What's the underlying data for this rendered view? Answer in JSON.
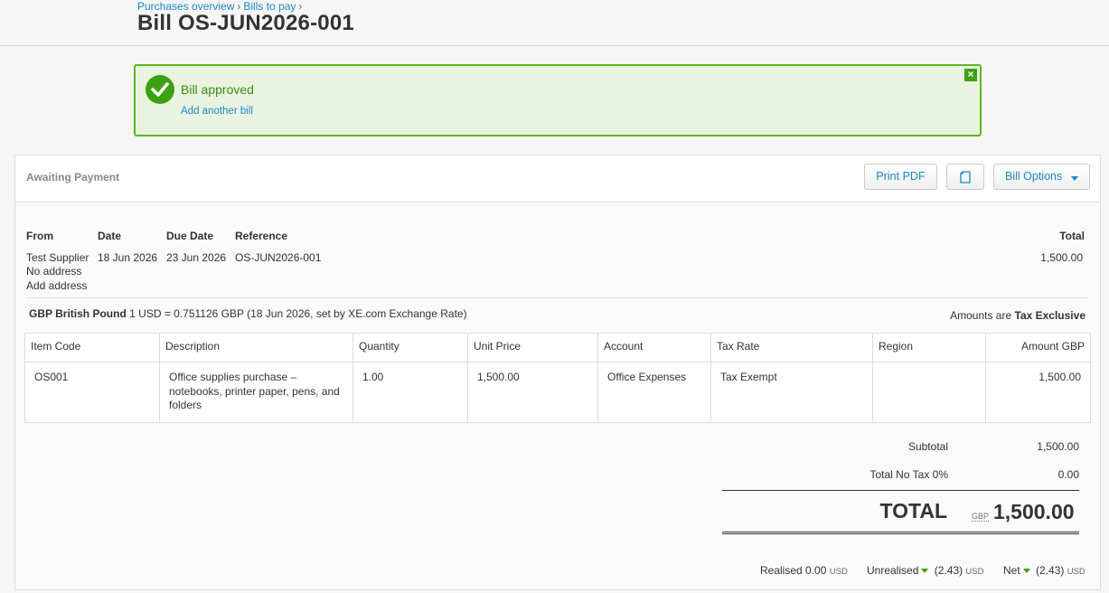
{
  "breadcrumb": [
    {
      "label": "Purchases overview"
    },
    {
      "label": "Bills to pay"
    }
  ],
  "breadcrumb_separator": "›",
  "title": "Bill OS-JUN2026-001",
  "banner": {
    "message": "Bill approved",
    "link": "Add another bill",
    "close": "×"
  },
  "status": "Awaiting Payment",
  "toolbar": {
    "print_label": "Print PDF",
    "options_label": "Bill Options"
  },
  "details": {
    "from_label": "From",
    "date_label": "Date",
    "due_label": "Due Date",
    "reference_label": "Reference",
    "total_label": "Total",
    "supplier": "Test Supplier",
    "no_address": "No address",
    "add_address": "Add address",
    "date": "18 Jun 2026",
    "due_date": "23 Jun 2026",
    "reference": "OS-JUN2026-001",
    "total": "1,500.00"
  },
  "currency": {
    "name": "GBP British Pound",
    "rate_text": "1 USD = 0.751126 GBP (18 Jun 2026, set by XE.com Exchange Rate)"
  },
  "tax_mode": {
    "prefix": "Amounts are",
    "value": "Tax Exclusive"
  },
  "table": {
    "headers": [
      "Item Code",
      "Description",
      "Quantity",
      "Unit Price",
      "Account",
      "Tax Rate",
      "Region",
      "Amount GBP"
    ],
    "rows": [
      {
        "item_code": "OS001",
        "description": "Office supplies purchase – notebooks, printer paper, pens, and folders",
        "quantity": "1.00",
        "unit_price": "1,500.00",
        "account": "Office Expenses",
        "tax_rate": "Tax Exempt",
        "region": "",
        "amount": "1,500.00"
      }
    ]
  },
  "totals": {
    "subtotal_label": "Subtotal",
    "subtotal": "1,500.00",
    "tax_label": "Total No Tax 0%",
    "tax": "0.00",
    "grand_label": "TOTAL",
    "grand_currency": "GBP",
    "grand_value": "1,500.00"
  },
  "footer": {
    "realised_label": "Realised",
    "realised_value": "0.00",
    "realised_ccy": "USD",
    "unrealised_label": "Unrealised",
    "unrealised_value": "(2.43)",
    "unrealised_ccy": "USD",
    "net_label": "Net",
    "net_value": "(2.43)",
    "net_ccy": "USD"
  },
  "colors": {
    "link": "#1d87c9",
    "success": "#3da113",
    "banner_bg": "#e9f3e0"
  }
}
